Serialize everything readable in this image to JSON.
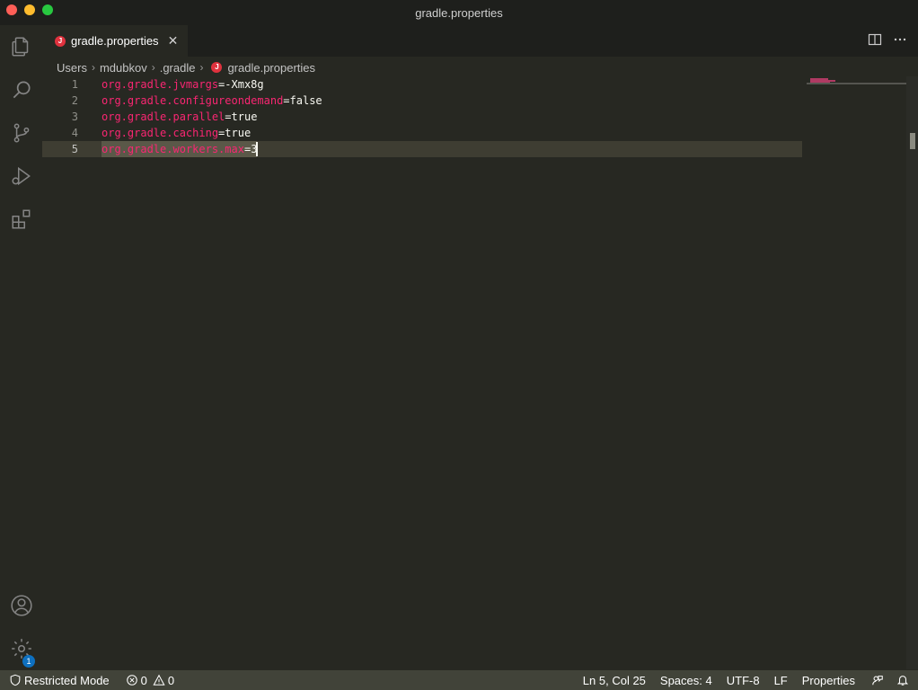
{
  "window": {
    "title": "gradle.properties"
  },
  "tabs": [
    {
      "label": "gradle.properties",
      "icon": "java-file-icon",
      "active": true
    }
  ],
  "breadcrumb": {
    "items": [
      "Users",
      "mdubkov",
      ".gradle",
      "gradle.properties"
    ]
  },
  "editor": {
    "lines": [
      {
        "number": "1",
        "key": "org.gradle.jvmargs",
        "eq": "=",
        "value": "-Xmx8g"
      },
      {
        "number": "2",
        "key": "org.gradle.configureondemand",
        "eq": "=",
        "value": "false"
      },
      {
        "number": "3",
        "key": "org.gradle.parallel",
        "eq": "=",
        "value": "true"
      },
      {
        "number": "4",
        "key": "org.gradle.caching",
        "eq": "=",
        "value": "true"
      },
      {
        "number": "5",
        "key": "org.gradle.workers.max",
        "eq": "=",
        "value": "3"
      }
    ]
  },
  "activity_bar": {
    "items": [
      "explorer-icon",
      "search-icon",
      "source-control-icon",
      "run-debug-icon",
      "extensions-icon"
    ],
    "bottom": [
      "account-icon",
      "manage-gear-icon"
    ],
    "settings_badge": "1"
  },
  "statusbar": {
    "restricted_mode": "Restricted Mode",
    "errors": "0",
    "warnings": "0",
    "cursor_position": "Ln 5, Col 25",
    "spaces": "Spaces: 4",
    "encoding": "UTF-8",
    "eol": "LF",
    "language": "Properties"
  },
  "colors": {
    "editor_bg": "#272822",
    "key": "#f92672",
    "value": "#f8f8f2",
    "statusbar_bg": "#414339",
    "badge": "#0e70c0"
  }
}
